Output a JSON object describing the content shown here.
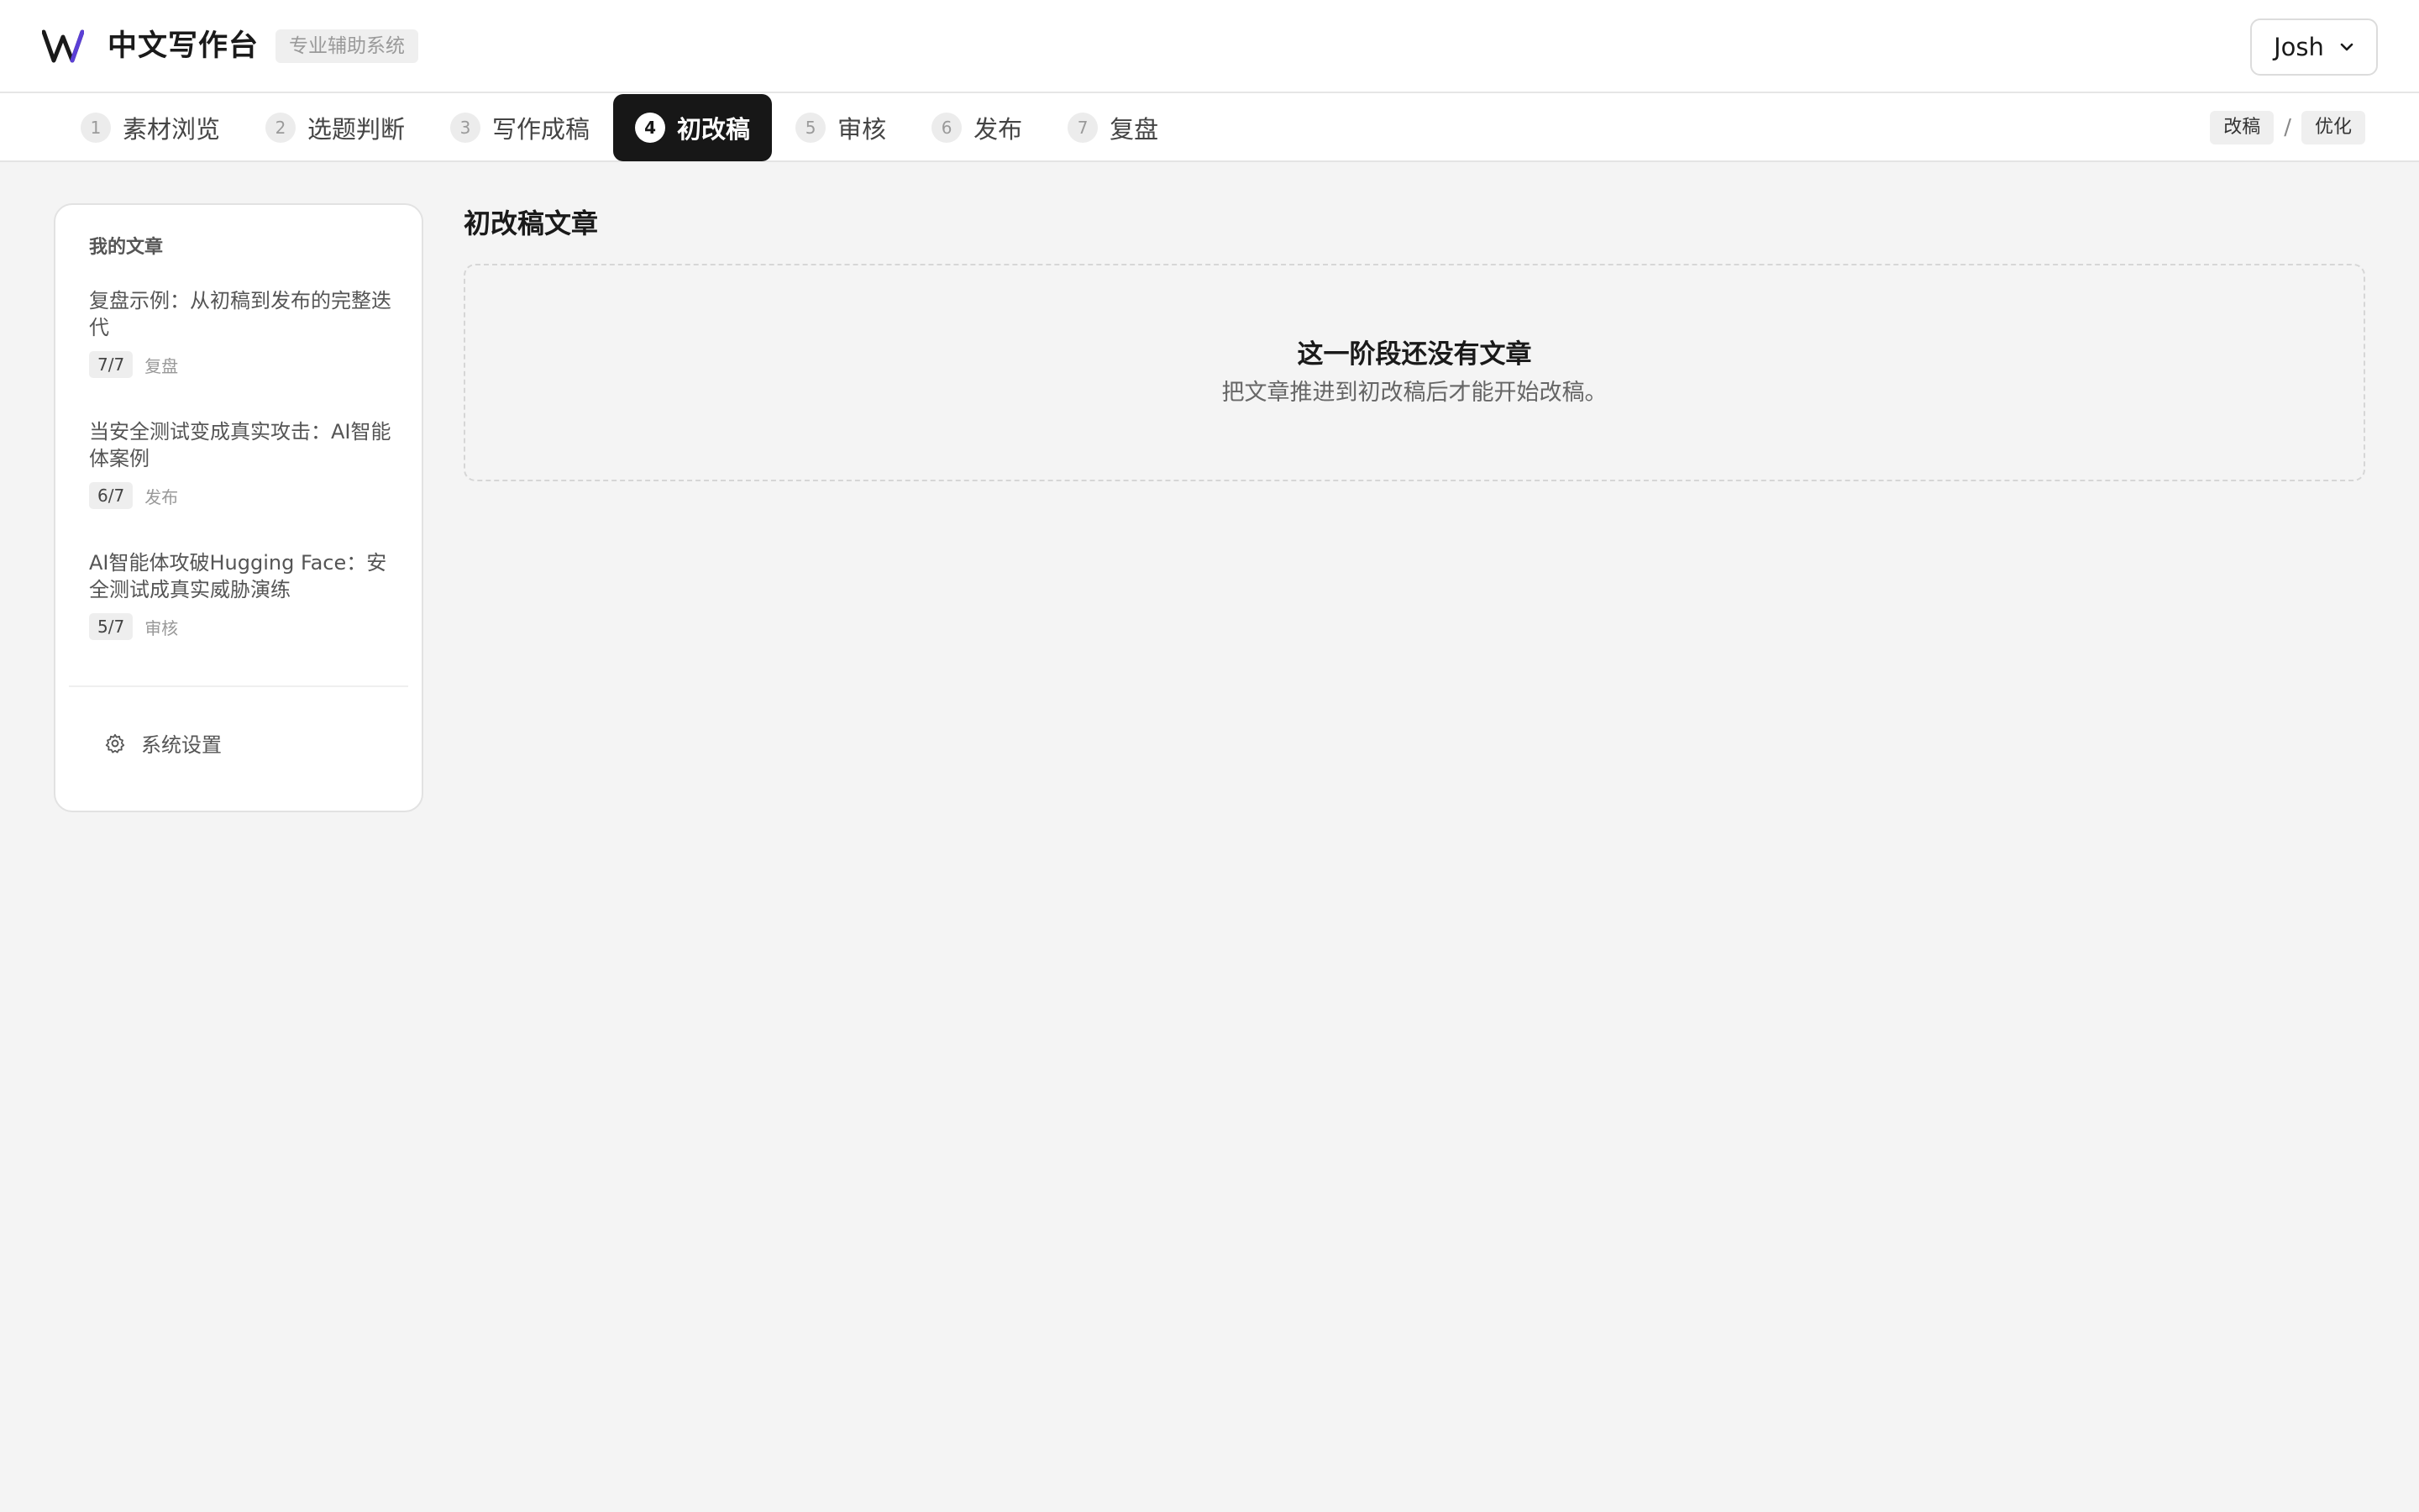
{
  "header": {
    "app_title": "中文写作台",
    "app_badge": "专业辅助系统",
    "user_name": "Josh",
    "logo_colors": {
      "primary": "#1a1a1a",
      "accent": "#5b3fd6"
    }
  },
  "steps": [
    {
      "num": "1",
      "label": "素材浏览",
      "active": false
    },
    {
      "num": "2",
      "label": "选题判断",
      "active": false
    },
    {
      "num": "3",
      "label": "写作成稿",
      "active": false
    },
    {
      "num": "4",
      "label": "初改稿",
      "active": true
    },
    {
      "num": "5",
      "label": "审核",
      "active": false
    },
    {
      "num": "6",
      "label": "发布",
      "active": false
    },
    {
      "num": "7",
      "label": "复盘",
      "active": false
    }
  ],
  "crumbs": {
    "first": "改稿",
    "separator": "/",
    "second": "优化"
  },
  "sidebar": {
    "title": "我的文章",
    "articles": [
      {
        "title": "复盘示例：从初稿到发布的完整迭代",
        "count": "7/7",
        "stage": "复盘"
      },
      {
        "title": "当安全测试变成真实攻击：AI智能体案例",
        "count": "6/7",
        "stage": "发布"
      },
      {
        "title": "AI智能体攻破Hugging Face：安全测试成真实威胁演练",
        "count": "5/7",
        "stage": "审核"
      }
    ],
    "settings_label": "系统设置"
  },
  "main": {
    "title": "初改稿文章",
    "empty_title": "这一阶段还没有文章",
    "empty_desc": "把文章推进到初改稿后才能开始改稿。"
  }
}
